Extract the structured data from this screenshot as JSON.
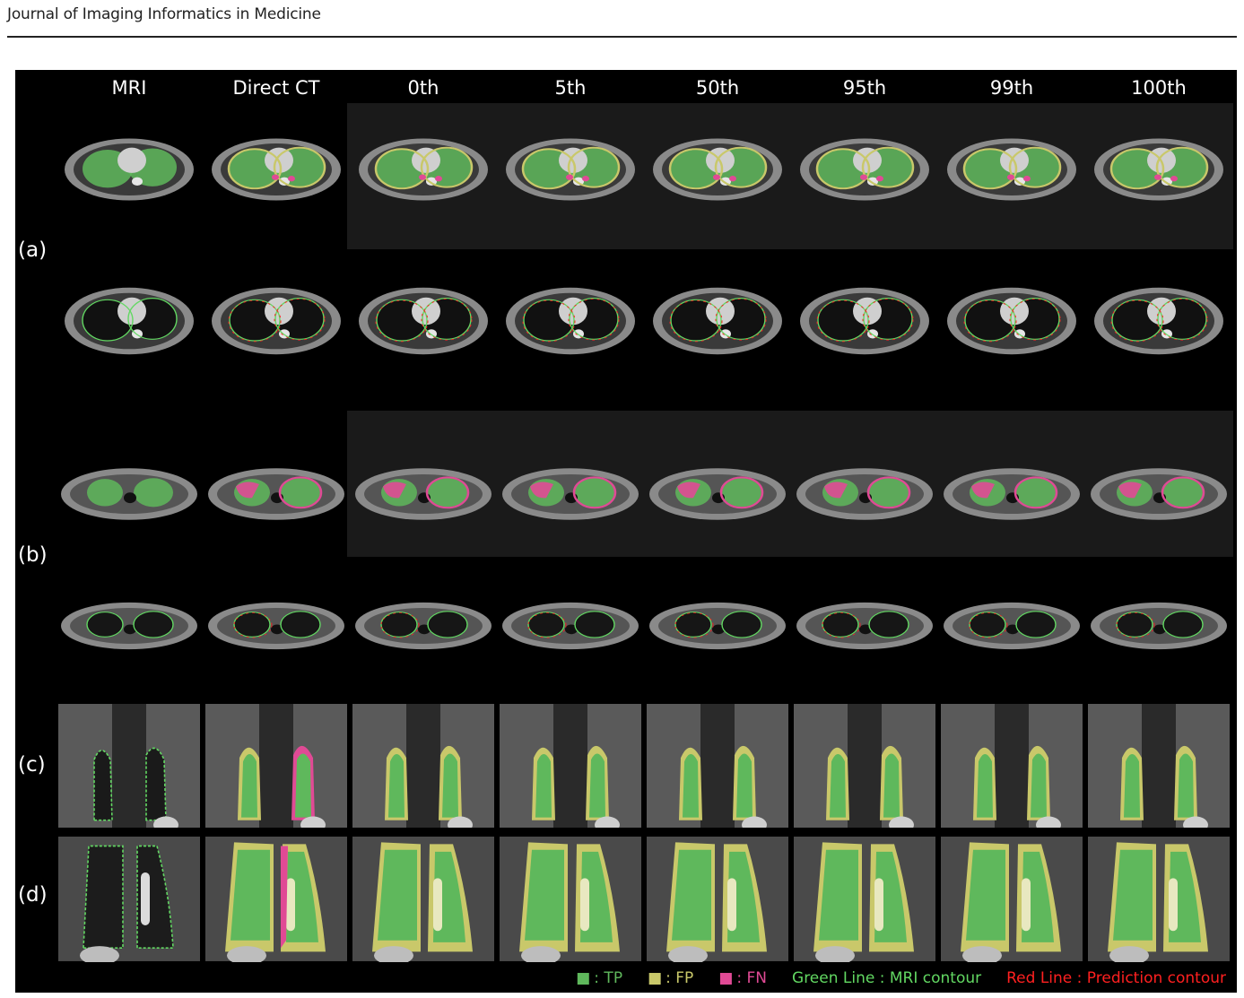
{
  "header": {
    "journal": "Journal of Imaging Informatics in Medicine"
  },
  "columns": [
    "MRI",
    "Direct CT",
    "0th",
    "5th",
    "50th",
    "95th",
    "99th",
    "100th"
  ],
  "row_labels": [
    "(a)",
    "(b)",
    "(c)",
    "(d)"
  ],
  "legend": {
    "tp_symbol": "■",
    "tp_label": ": TP",
    "fp_symbol": "■",
    "fp_label": ": FP",
    "fn_symbol": "■",
    "fn_label": ": FN",
    "green_line": "Green Line : MRI contour",
    "red_line": "Red Line : Prediction contour"
  },
  "colors": {
    "tp": "#5fb85c",
    "fp": "#c9c86a",
    "fn": "#e04a95",
    "green_line": "#62d862",
    "red_line": "#ff2020",
    "arrow": "#4fd8f0"
  }
}
